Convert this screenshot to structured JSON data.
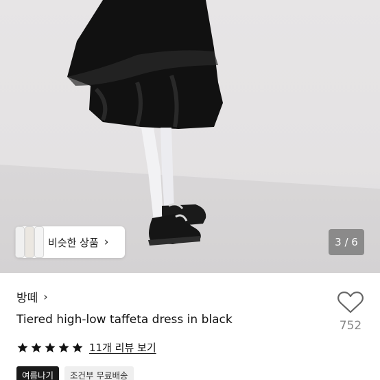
{
  "gallery": {
    "similar_label": "비슷한 상품",
    "similar_chevron": "›",
    "page_counter": "3 / 6"
  },
  "product": {
    "shop_name": "방떼",
    "shop_chevron": "›",
    "title": "Tiered high-low taffeta dress in black",
    "like_count": "752",
    "rating": 5,
    "review_link": "11개 리뷰 보기",
    "tags": [
      "여름나기",
      "조건부 무료배송"
    ]
  },
  "colors": {
    "accent": "#111111",
    "muted": "#888888",
    "dress": "#121212"
  },
  "icons": [
    "heart-outline-icon",
    "star-icon",
    "chevron-right-icon"
  ]
}
